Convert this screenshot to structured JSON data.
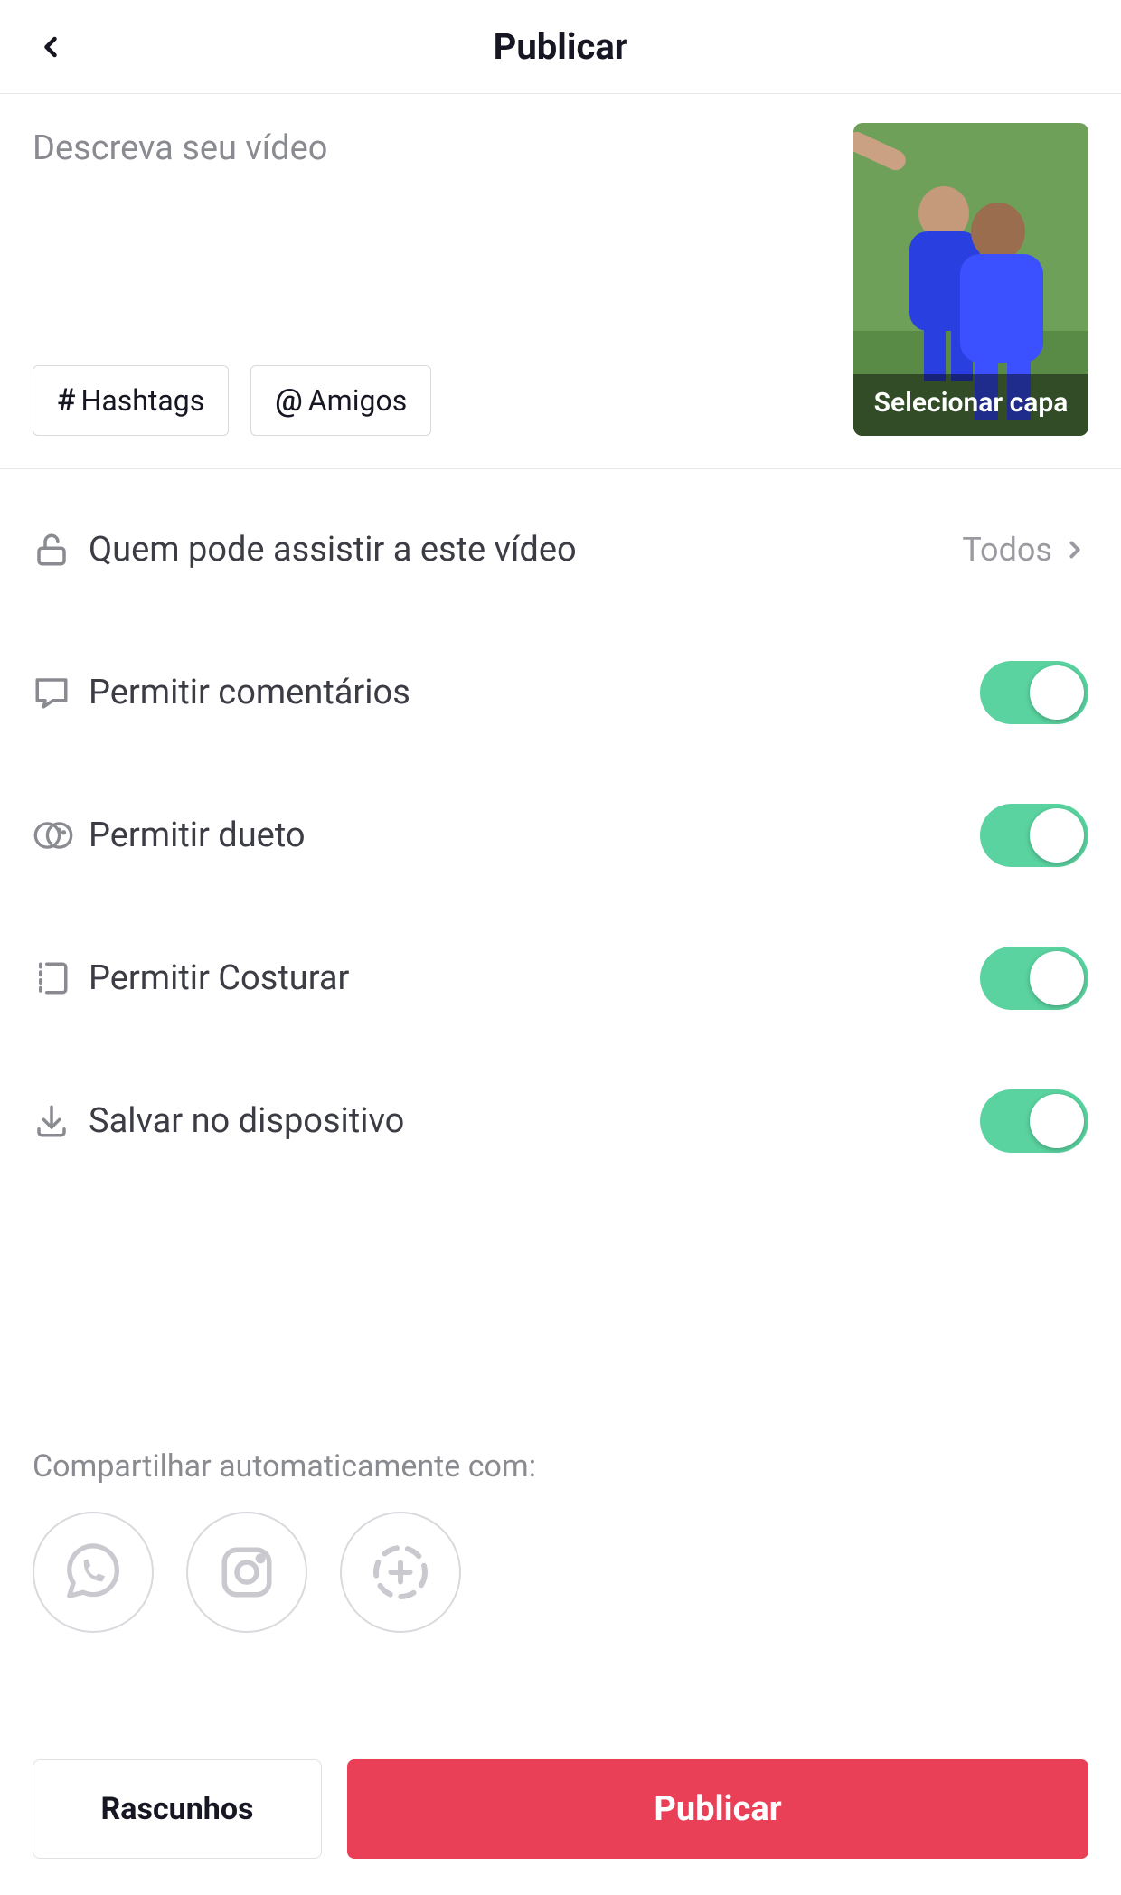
{
  "header": {
    "title": "Publicar"
  },
  "compose": {
    "placeholder": "Descreva seu vídeo",
    "hashtags_label": "Hashtags",
    "friends_label": "Amigos",
    "select_cover_label": "Selecionar capa"
  },
  "settings": {
    "privacy_label": "Quem pode assistir a este vídeo",
    "privacy_value": "Todos",
    "comments_label": "Permitir comentários",
    "duet_label": "Permitir dueto",
    "stitch_label": "Permitir Costurar",
    "save_label": "Salvar no dispositivo"
  },
  "share": {
    "label": "Compartilhar automaticamente com:"
  },
  "footer": {
    "drafts_label": "Rascunhos",
    "publish_label": "Publicar"
  },
  "colors": {
    "accent": "#e94057",
    "toggle_on": "#5ad3a0"
  }
}
